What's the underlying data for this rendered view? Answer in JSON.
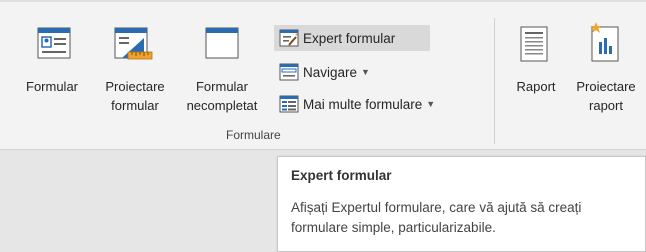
{
  "ribbon": {
    "group_formulare": {
      "label": "Formulare",
      "buttons": {
        "formular": {
          "line1": "Formular",
          "icon": "form-icon"
        },
        "proiectare_formular": {
          "line1": "Proiectare",
          "line2": "formular",
          "icon": "form-design-icon"
        },
        "formular_necompletat": {
          "line1": "Formular",
          "line2": "necompletat",
          "icon": "blank-form-icon"
        },
        "expert_formular": {
          "label": "Expert formular",
          "icon": "form-wizard-icon",
          "highlighted": true
        },
        "navigare": {
          "label": "Navigare",
          "icon": "navigation-icon",
          "dropdown": true
        },
        "mai_multe_formulare": {
          "label": "Mai multe formulare",
          "icon": "more-forms-icon",
          "dropdown": true
        }
      }
    },
    "group_rapoarte": {
      "buttons": {
        "raport": {
          "line1": "Raport",
          "icon": "report-icon"
        },
        "proiectare_raport": {
          "line1": "Proiectare",
          "line2": "raport",
          "icon": "report-design-icon"
        }
      }
    }
  },
  "tooltip": {
    "title": "Expert formular",
    "description": "Afișați Expertul formulare, care vă ajută să creați formulare simple, particularizabile."
  },
  "colors": {
    "ribbon_bg": "#f3f3f3",
    "workspace_bg": "#e6e6e6",
    "highlight_bg": "#d9d9d9",
    "icon_blue": "#2b6cb0",
    "icon_orange": "#f2a22b"
  }
}
